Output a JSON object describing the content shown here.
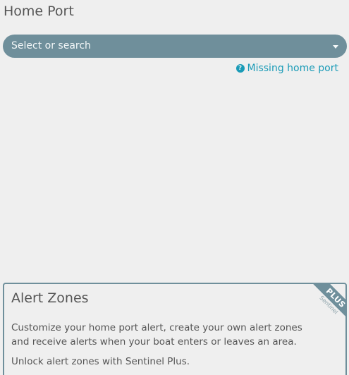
{
  "home_port": {
    "title": "Home Port",
    "select_placeholder": "Select or search",
    "help_icon": "question-circle-icon",
    "help_label": "Missing home port"
  },
  "alert_zones": {
    "title": "Alert Zones",
    "description": "Customize your home port alert, create your own alert zones and receive alerts when your boat enters or leaves an area.",
    "unlock_text": "Unlock alert zones with Sentinel Plus.",
    "ribbon_label": "PLUS",
    "ribbon_sub": "Sentinel"
  },
  "colors": {
    "accent": "#6f8f9b",
    "link": "#1a9bb7",
    "background": "#efefef",
    "text": "#555555"
  }
}
